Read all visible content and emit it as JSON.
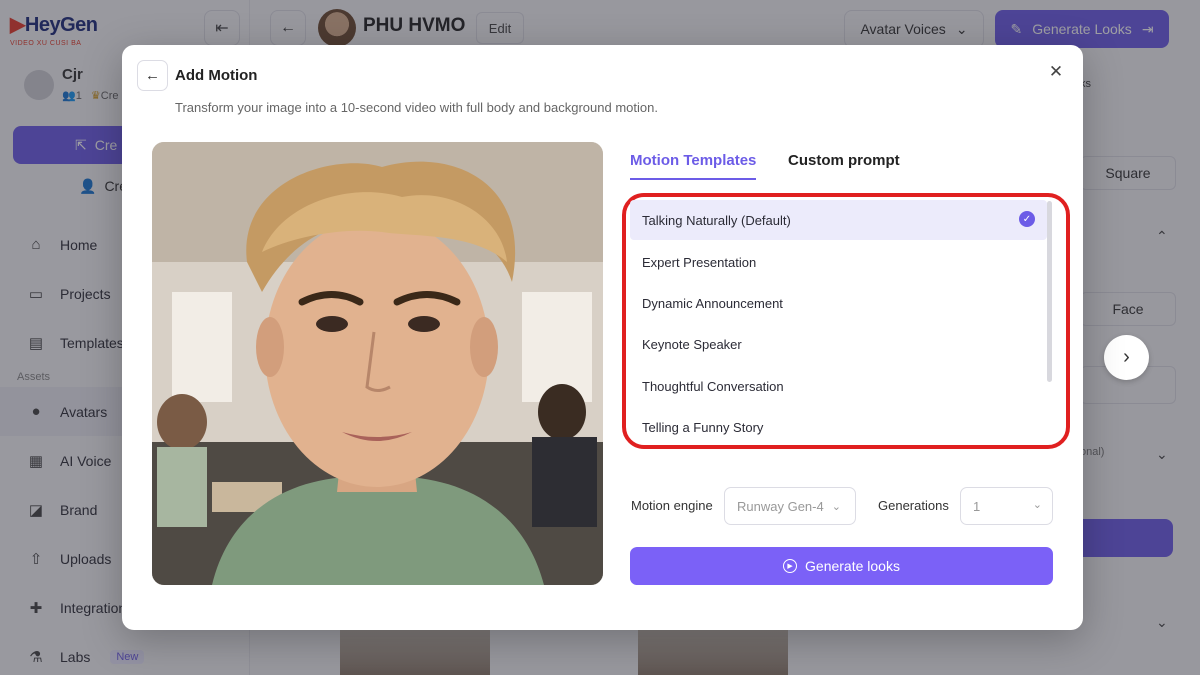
{
  "colors": {
    "accent": "#6c5ce7",
    "generate_button": "#7b61f7",
    "highlight_ring": "#e02020",
    "selected_row": "#ecebfb"
  },
  "logo": {
    "word": "HeyGen",
    "sub": "VIDEO XU CUSI BA"
  },
  "workspace": {
    "name": "Cjr",
    "members": "1",
    "credits_fragment": "Cre"
  },
  "sidebar": {
    "create_label": "Cre",
    "create_avatar_label": "Crea",
    "nav": [
      {
        "label": "Home",
        "icon": "home-icon"
      },
      {
        "label": "Projects",
        "icon": "folder-icon"
      },
      {
        "label": "Templates",
        "icon": "templates-icon"
      }
    ],
    "section_label": "Assets",
    "assets": [
      {
        "label": "Avatars",
        "icon": "avatar-icon"
      },
      {
        "label": "AI Voice",
        "icon": "voice-icon"
      },
      {
        "label": "Brand",
        "icon": "brand-icon"
      },
      {
        "label": "Uploads",
        "icon": "upload-icon"
      },
      {
        "label": "Integration",
        "icon": "puzzle-icon"
      },
      {
        "label": "Labs",
        "icon": "flask-icon",
        "badge": "New"
      }
    ]
  },
  "header": {
    "avatar_name": "PHU HVMO",
    "edit_label": "Edit",
    "voices_label": "Avatar Voices",
    "generate_looks_label": "Generate Looks"
  },
  "right_panel": {
    "looks_fragment": "ks",
    "square_label": "Square",
    "face_label": "Face",
    "optional_fragment": "onal)"
  },
  "modal": {
    "title": "Add Motion",
    "subtitle": "Transform your image into a 10-second video with full body and background motion.",
    "tabs": [
      {
        "label": "Motion Templates",
        "active": true
      },
      {
        "label": "Custom prompt",
        "active": false
      }
    ],
    "templates": [
      {
        "label": "Talking Naturally (Default)",
        "selected": true
      },
      {
        "label": "Expert Presentation",
        "selected": false
      },
      {
        "label": "Dynamic Announcement",
        "selected": false
      },
      {
        "label": "Keynote Speaker",
        "selected": false
      },
      {
        "label": "Thoughtful Conversation",
        "selected": false
      },
      {
        "label": "Telling a Funny Story",
        "selected": false
      }
    ],
    "motion_engine_label": "Motion engine",
    "motion_engine_value": "Runway Gen-4",
    "generations_label": "Generations",
    "generations_value": "1",
    "generate_button_label": "Generate looks"
  }
}
